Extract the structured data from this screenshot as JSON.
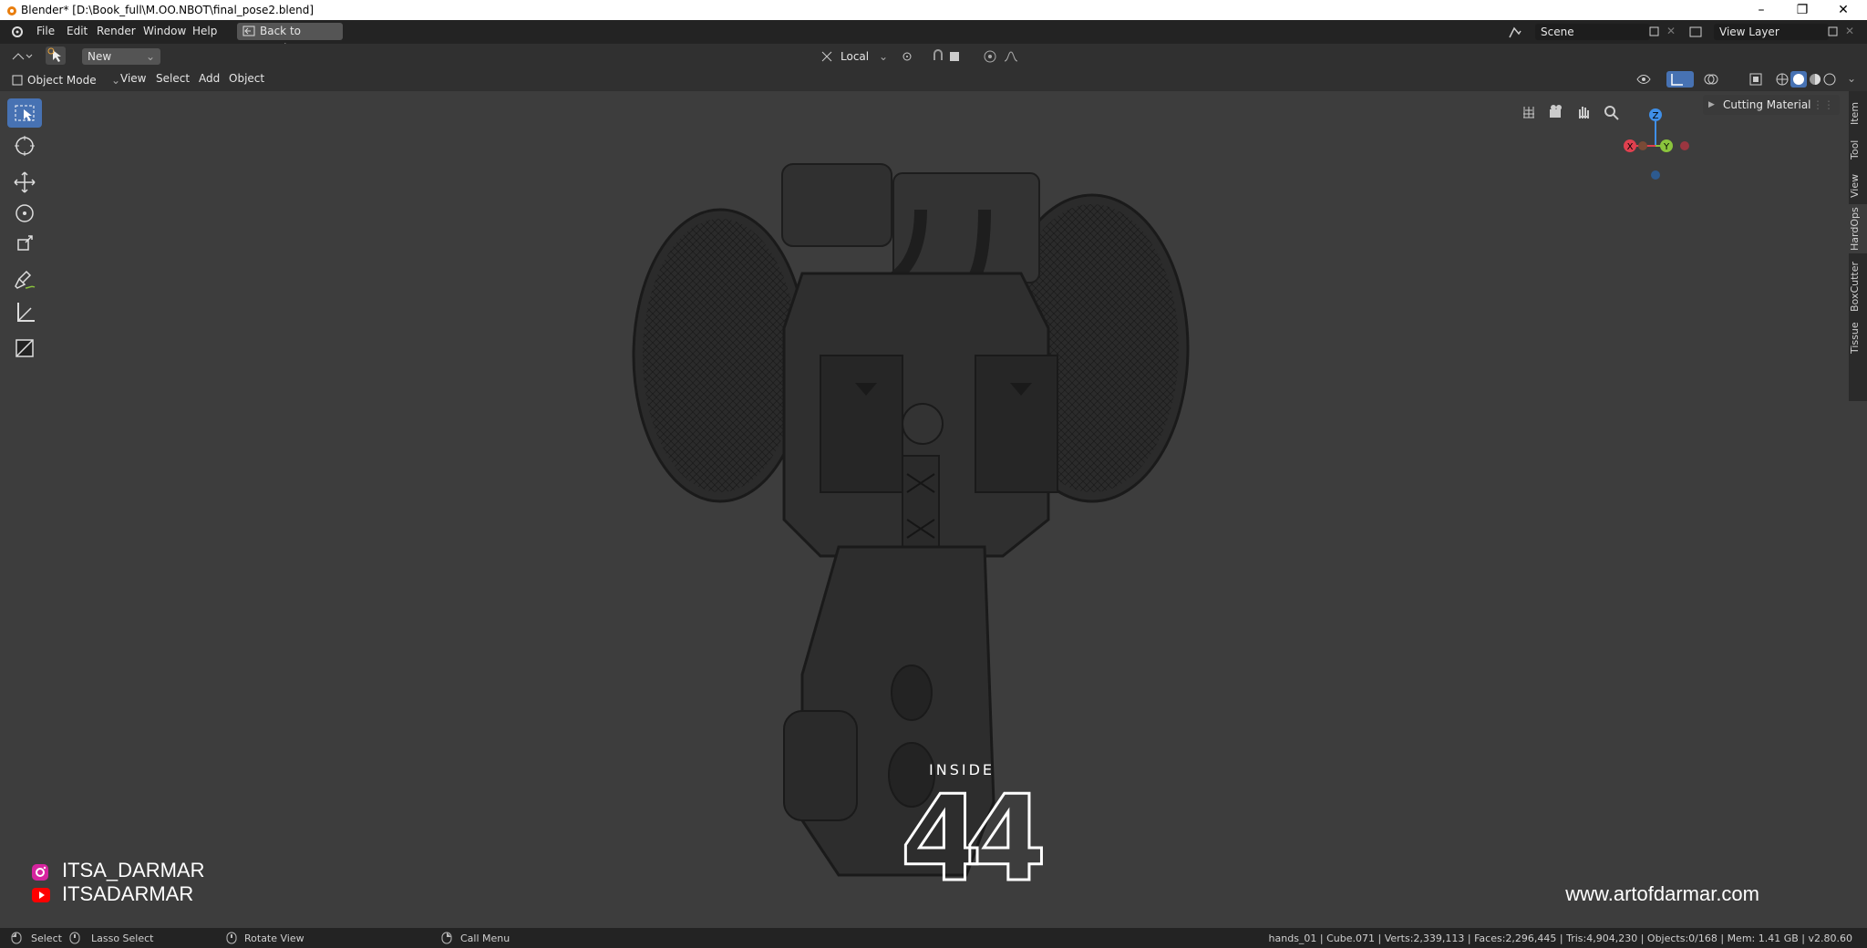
{
  "window": {
    "title": "Blender* [D:\\Book_full\\M.OO.NBOT\\final_pose2.blend]"
  },
  "menubar": {
    "items": [
      "File",
      "Edit",
      "Render",
      "Window",
      "Help"
    ],
    "back_button": "Back to Previous",
    "scene_name": "Scene",
    "view_layer_name": "View Layer"
  },
  "header": {
    "new_label": "New",
    "transform_orientation": "Local"
  },
  "viewport_header": {
    "mode": "Object Mode",
    "menus": [
      "View",
      "Select",
      "Add",
      "Object"
    ]
  },
  "gizmo": {
    "z": "Z",
    "x": "X",
    "y": "Y"
  },
  "npanel": {
    "cutting_material": "Cutting Material"
  },
  "sidetabs": [
    "Item",
    "Tool",
    "View",
    "HardOps",
    "BoxCutter",
    "Tissue"
  ],
  "watermark": {
    "inside": "INSIDE",
    "number": "44"
  },
  "social": {
    "instagram": "ITSA_DARMAR",
    "youtube": "ITSADARMAR"
  },
  "website": "www.artofdarmar.com",
  "statusbar": {
    "select": "Select",
    "lasso": "Lasso Select",
    "rotate": "Rotate View",
    "call_menu": "Call Menu",
    "stats": "hands_01 | Cube.071 | Verts:2,339,113 | Faces:2,296,445 | Tris:4,904,230 | Objects:0/168 | Mem: 1.41 GB | v2.80.60"
  },
  "colors": {
    "accent": "#4772b3",
    "axis_x": "#e0404f",
    "axis_y": "#8bc43d",
    "axis_z": "#3f8fe8",
    "instagram": "#d6249f",
    "youtube": "#ff0000"
  },
  "icons": [
    "blender-logo-icon",
    "minimize-icon",
    "restore-icon",
    "close-icon",
    "select-box-icon",
    "cursor-icon",
    "move-icon",
    "rotate-icon",
    "scale-icon",
    "annotate-icon",
    "measure-icon",
    "add-cube-icon",
    "grid-view-icon",
    "camera-icon",
    "hand-pan-icon",
    "zoom-icon"
  ]
}
